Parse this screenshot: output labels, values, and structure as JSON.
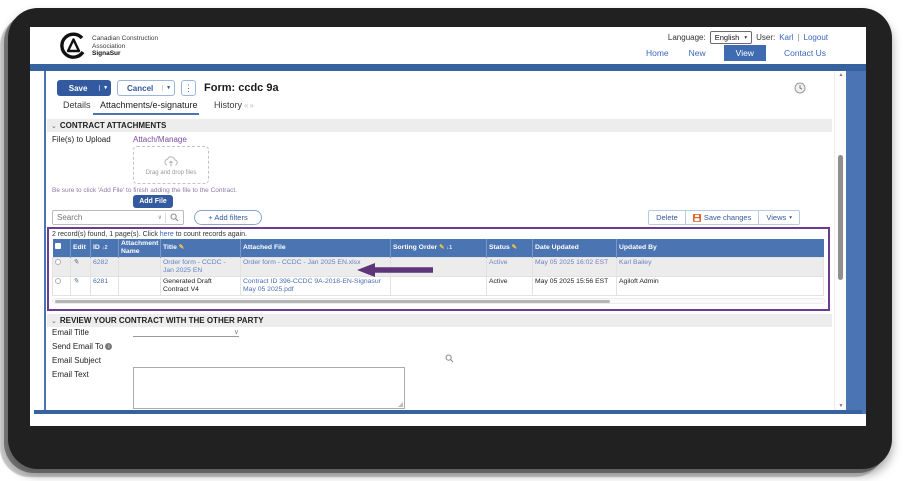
{
  "header": {
    "org_line1": "Canadian Construction",
    "org_line2": "Association",
    "product": "SignaSur",
    "language_label": "Language:",
    "language_value": "English",
    "user_label": "User:",
    "user_name": "Karl",
    "separator": "|",
    "logout_label": "Logout",
    "nav": {
      "home": "Home",
      "new": "New",
      "view": "View",
      "contact": "Contact Us"
    }
  },
  "toolbar": {
    "save_label": "Save",
    "cancel_label": "Cancel",
    "form_title": "Form: ccdc 9a"
  },
  "tabs": {
    "details": "Details",
    "attachments": "Attachments/e-signature",
    "history": "History"
  },
  "attachments_section": {
    "title": "CONTRACT ATTACHMENTS",
    "upload_label": "File(s) to Upload",
    "attach_manage_label": "Attach/Manage",
    "dropzone_label": "Drag and drop files",
    "helper_text": "Be sure to click 'Add File' to finish adding the file to the Contract.",
    "add_file_label": "Add File",
    "search_placeholder": "Search",
    "add_filters_label": "+ Add filters",
    "delete_label": "Delete",
    "save_changes_label": "Save changes",
    "views_label": "Views"
  },
  "records": {
    "summary_prefix": "2 record(s) found, 1 page(s). Click ",
    "summary_link": "here",
    "summary_suffix": " to count records again.",
    "columns": {
      "edit": "Edit",
      "id": "ID",
      "id_sort": "↓2",
      "attachment_name": "Attachment Name",
      "title": "Title",
      "attached_file": "Attached File",
      "sorting_order": "Sorting Order",
      "sorting_order_sort": "↓1",
      "status": "Status",
      "date_updated": "Date Updated",
      "updated_by": "Updated By"
    },
    "rows": [
      {
        "id": "6282",
        "attachment_name": "",
        "title": "Order form - CCDC - Jan 2025 EN",
        "attached_file": "Order form - CCDC - Jan 2025 EN.xlsx",
        "sorting_order": "",
        "status": "Active",
        "date_updated": "May 05 2025 16:02 EST",
        "updated_by": "Karl Bailey"
      },
      {
        "id": "6281",
        "attachment_name": "",
        "title": "Generated Draft Contract V4",
        "attached_file": "Contract ID 396-CCDC 9A-2018-EN-Signasur May 05 2025.pdf",
        "sorting_order": "",
        "status": "Active",
        "date_updated": "May 05 2025 15:56 EST",
        "updated_by": "Agiloft Admin"
      }
    ]
  },
  "review_section": {
    "title": "REVIEW YOUR CONTRACT WITH THE OTHER PARTY",
    "email_title_label": "Email Title",
    "send_email_to_label": "Send Email To",
    "email_subject_label": "Email Subject",
    "email_text_label": "Email Text"
  },
  "icons": {
    "kebab": "⋮",
    "caret_down": "▾",
    "search_caret": "∨",
    "section_caret": "⌄",
    "tab_scroll": "«»",
    "pencil": "✎",
    "scroll_up": "▲",
    "scroll_down": "▼",
    "info": "i"
  },
  "colors": {
    "accent_blue": "#33599e",
    "bar_blue": "#36639f",
    "table_header_blue": "#4a74b2",
    "link_blue": "#3a67b8",
    "purple_link": "#7d4b9e",
    "annotation_purple": "#6a3d91",
    "row_selected_text": "#7080c2",
    "save_icon_orange": "#e2622a"
  }
}
